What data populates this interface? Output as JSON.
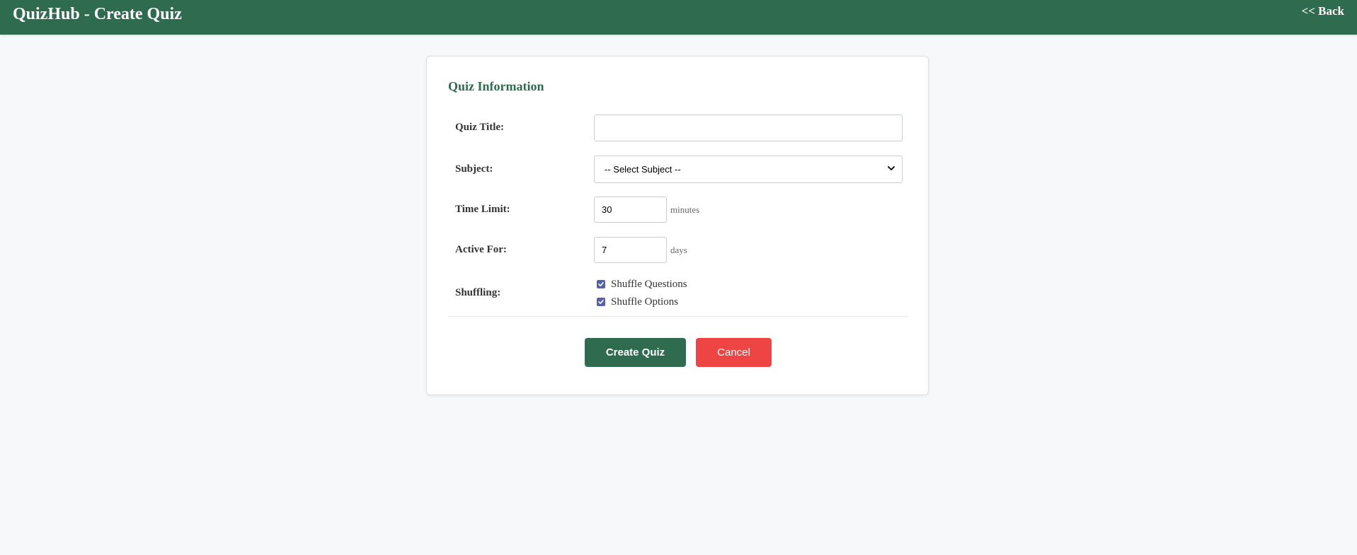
{
  "header": {
    "title": "QuizHub - Create Quiz",
    "back_label": "<< Back"
  },
  "form": {
    "section_title": "Quiz Information",
    "title_field": {
      "label": "Quiz Title:",
      "value": ""
    },
    "subject_field": {
      "label": "Subject:",
      "selected": "-- Select Subject --"
    },
    "time_limit_field": {
      "label": "Time Limit:",
      "value": "30",
      "unit": "minutes"
    },
    "active_for_field": {
      "label": "Active For:",
      "value": "7",
      "unit": "days"
    },
    "shuffling": {
      "label": "Shuffling:",
      "options": [
        {
          "label": "Shuffle Questions",
          "checked": true
        },
        {
          "label": "Shuffle Options",
          "checked": true
        }
      ]
    }
  },
  "actions": {
    "create_label": "Create Quiz",
    "cancel_label": "Cancel"
  },
  "colors": {
    "brand": "#2e6b4f",
    "danger": "#ef4444",
    "checkbox": "#5661a8"
  }
}
